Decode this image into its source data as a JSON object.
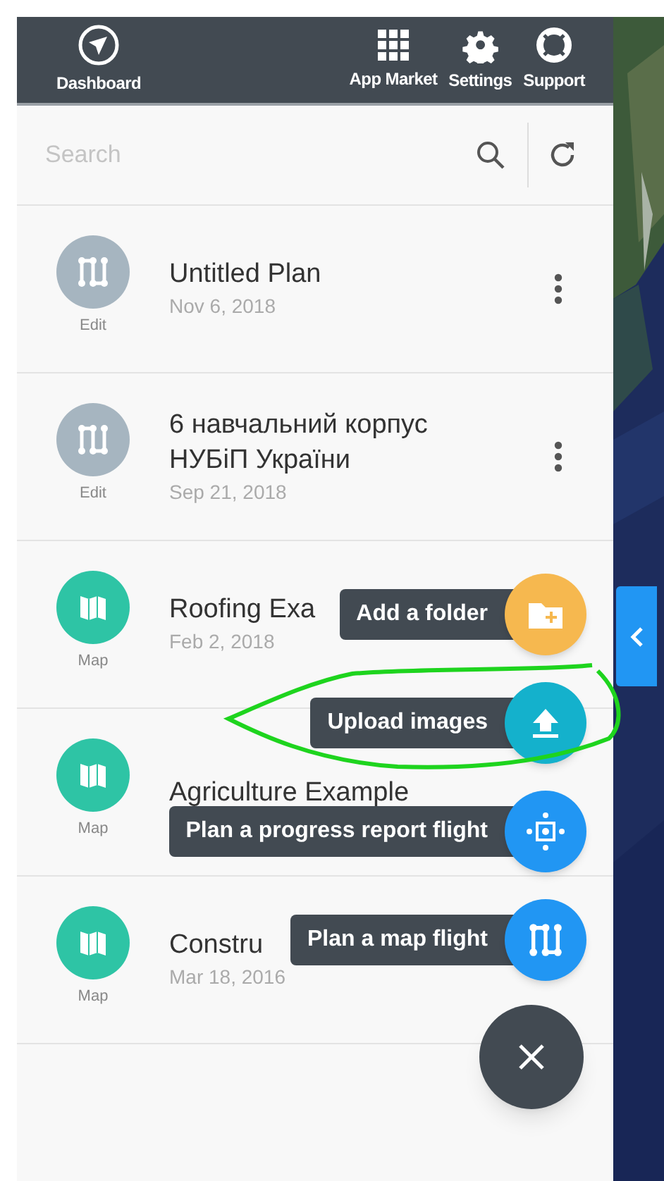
{
  "nav": [
    {
      "label": "Dashboard"
    },
    {
      "label": "App Market"
    },
    {
      "label": "Settings"
    },
    {
      "label": "Support"
    }
  ],
  "search": {
    "placeholder": "Search"
  },
  "plans": [
    {
      "kind": "edit",
      "badge": "Edit",
      "title": "Untitled Plan",
      "date": "Nov 6, 2018"
    },
    {
      "kind": "edit",
      "badge": "Edit",
      "title": "6 навчальний корпус НУБіП України",
      "date": "Sep 21, 2018"
    },
    {
      "kind": "map",
      "badge": "Map",
      "title": "Roofing Exa",
      "date": "Feb 2, 2018"
    },
    {
      "kind": "map",
      "badge": "Map",
      "title": "Agriculture Example"
    },
    {
      "kind": "map",
      "badge": "Map",
      "title": "Constru",
      "date": "Mar 18, 2016"
    }
  ],
  "actions": [
    {
      "kind": "folder",
      "label": "Add a folder",
      "color": "#f6b84f"
    },
    {
      "kind": "upload",
      "label": "Upload images",
      "color": "#14b1cc"
    },
    {
      "kind": "progress",
      "label": "Plan a progress report flight",
      "color": "#2196f3"
    },
    {
      "kind": "mapflight",
      "label": "Plan a map flight",
      "color": "#2196f3"
    }
  ]
}
